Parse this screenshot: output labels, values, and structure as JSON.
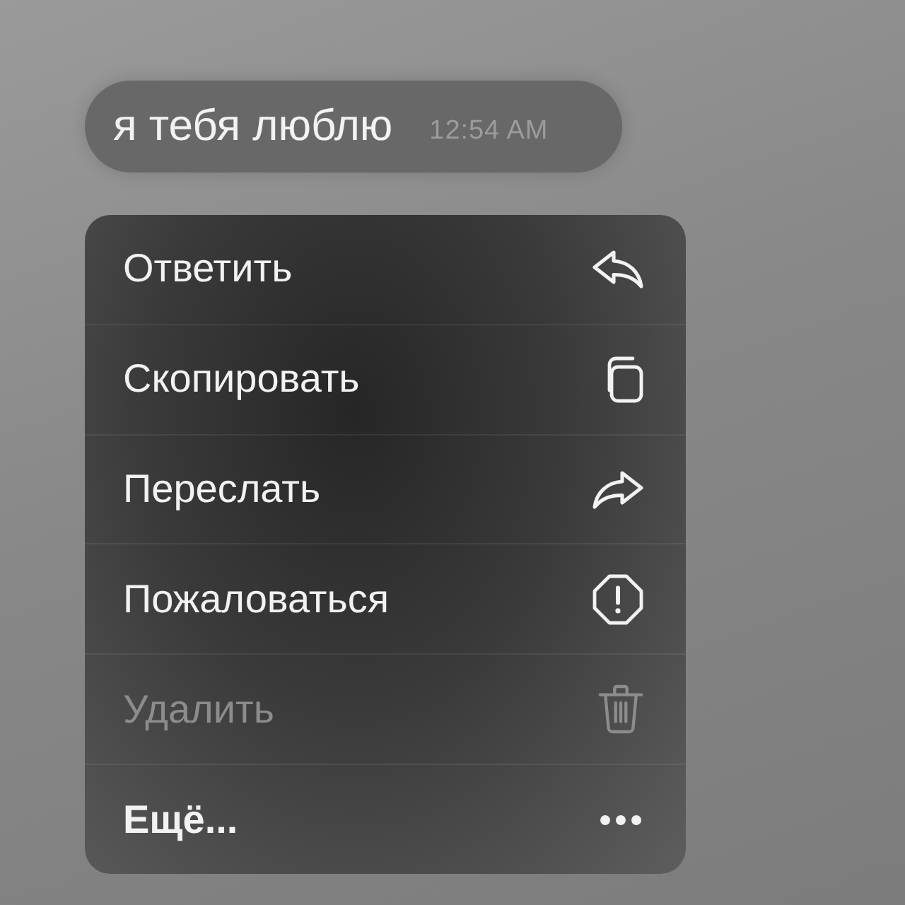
{
  "message": {
    "text": "я тебя люблю",
    "time": "12:54 AM"
  },
  "menu": {
    "items": [
      {
        "label": "Ответить",
        "kind": "action",
        "disabled": false
      },
      {
        "label": "Скопировать",
        "kind": "action",
        "disabled": false
      },
      {
        "label": "Переслать",
        "kind": "action",
        "disabled": false
      },
      {
        "label": "Пожаловаться",
        "kind": "action",
        "disabled": false
      },
      {
        "label": "Удалить",
        "kind": "action",
        "disabled": true
      },
      {
        "label": "Ещё...",
        "kind": "more",
        "disabled": false
      }
    ]
  }
}
